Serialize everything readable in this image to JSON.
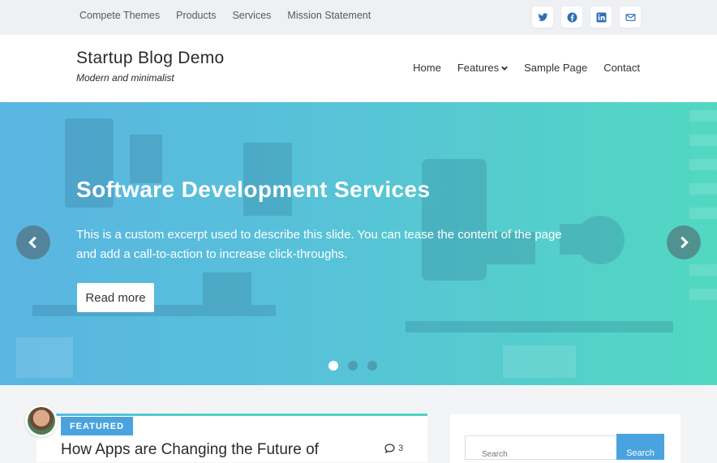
{
  "topbar": {
    "links": [
      "Compete Themes",
      "Products",
      "Services",
      "Mission Statement"
    ],
    "social_icons": [
      "twitter-icon",
      "facebook-icon",
      "linkedin-icon",
      "email-icon"
    ],
    "icon_color": "#2f6fb3"
  },
  "header": {
    "site_title": "Startup Blog Demo",
    "tagline": "Modern and minimalist",
    "nav": [
      "Home",
      "Features",
      "Sample Page",
      "Contact"
    ]
  },
  "hero": {
    "title": "Software Development Services",
    "excerpt": "This is a custom excerpt used to describe this slide. You can tease the content of the page and add a call-to-action to increase click-throughs.",
    "button": "Read more",
    "active_slide": 1,
    "slide_count": 3,
    "gradient": [
      "#5ab5e2",
      "#52d8c2"
    ]
  },
  "post": {
    "badge": "FEATURED",
    "title": "How Apps are Changing the Future of",
    "comment_count": "3",
    "accent": "#4aa3df"
  },
  "sidebar": {
    "search_placeholder": "Search",
    "search_button": "Search"
  }
}
